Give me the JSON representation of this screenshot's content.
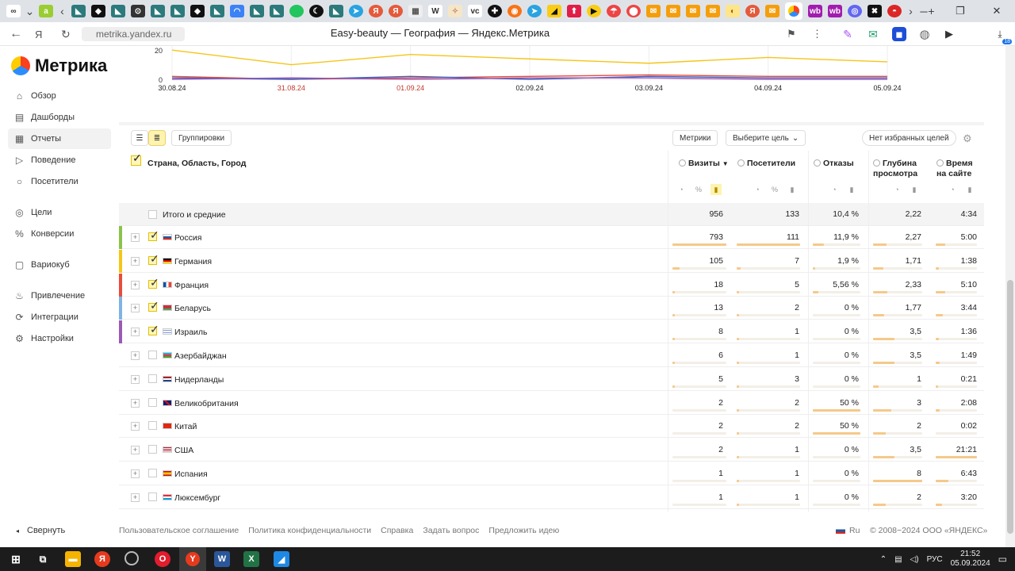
{
  "browser": {
    "url": "metrika.yandex.ru",
    "page_title": "Easy-beauty — География — Яндекс.Метрика",
    "tab_badge": "18"
  },
  "sidebar": {
    "logo": "Метрика",
    "items": [
      {
        "label": "Обзор",
        "icon": "home-icon"
      },
      {
        "label": "Дашборды",
        "icon": "dashboard-icon"
      },
      {
        "label": "Отчеты",
        "icon": "reports-icon",
        "active": true
      },
      {
        "label": "Поведение",
        "icon": "play-icon"
      },
      {
        "label": "Посетители",
        "icon": "user-icon"
      },
      {
        "label": "Цели",
        "icon": "target-icon"
      },
      {
        "label": "Конверсии",
        "icon": "percent-icon"
      },
      {
        "label": "Вариокуб",
        "icon": "cube-icon"
      },
      {
        "label": "Привлечение",
        "icon": "flame-icon"
      },
      {
        "label": "Интеграции",
        "icon": "plug-icon"
      },
      {
        "label": "Настройки",
        "icon": "gear-icon"
      }
    ],
    "collapse": "Свернуть"
  },
  "chart_data": {
    "type": "line",
    "x": [
      "30.08.24",
      "31.08.24",
      "01.09.24",
      "02.09.24",
      "03.09.24",
      "04.09.24",
      "05.09.24"
    ],
    "x_label_colors": [
      "#222",
      "#c0392b",
      "#c0392b",
      "#222",
      "#222",
      "#222",
      "#222"
    ],
    "y_ticks": [
      0,
      20
    ],
    "ylim": [
      0,
      25
    ],
    "series": [
      {
        "color": "#f5c518",
        "values": [
          20,
          10,
          17,
          14,
          11,
          15,
          12
        ]
      },
      {
        "color": "#e74c3c",
        "values": [
          2,
          0,
          1,
          2,
          3,
          2,
          2
        ]
      },
      {
        "color": "#3b5fc0",
        "values": [
          1,
          0,
          2,
          0,
          2,
          1,
          1
        ]
      },
      {
        "color": "#9b59b6",
        "values": [
          0,
          1,
          0,
          1,
          1,
          0,
          0
        ]
      }
    ]
  },
  "controls": {
    "groupings": "Группировки",
    "metrics": "Метрики",
    "choose_goal": "Выберите цель",
    "no_favorites": "Нет избранных целей"
  },
  "table": {
    "dimension_header": "Страна, Область, Город",
    "columns": [
      "Визиты",
      "Посетители",
      "Отказы",
      "Глубина просмотра",
      "Время на сайте"
    ],
    "col_visits": "Визиты",
    "col_visitors": "Посетители",
    "col_bounce": "Отказы",
    "col_depth_1": "Глубина",
    "col_depth_2": "просмотра",
    "col_time_1": "Время",
    "col_time_2": "на сайте",
    "sort_marker": "▼",
    "total": {
      "label": "Итого и средние",
      "visits": "956",
      "visitors": "133",
      "bounce": "10,4 %",
      "depth": "2,22",
      "time": "4:34"
    },
    "rows": [
      {
        "name": "Россия",
        "visits": "793",
        "visitors": "111",
        "bounce": "11,9 %",
        "depth": "2,27",
        "time": "5:00",
        "checked": true,
        "color": "#8bc34a",
        "vf": 1.0,
        "uf": 1.0,
        "bf": 0.24,
        "df": 0.28,
        "tf": 0.24
      },
      {
        "name": "Германия",
        "visits": "105",
        "visitors": "7",
        "bounce": "1,9 %",
        "depth": "1,71",
        "time": "1:38",
        "checked": true,
        "color": "#f5c518",
        "vf": 0.13,
        "uf": 0.06,
        "bf": 0.04,
        "df": 0.21,
        "tf": 0.08
      },
      {
        "name": "Франция",
        "visits": "18",
        "visitors": "5",
        "bounce": "5,56 %",
        "depth": "2,33",
        "time": "5:10",
        "checked": true,
        "color": "#e74c3c",
        "vf": 0.02,
        "uf": 0.04,
        "bf": 0.11,
        "df": 0.29,
        "tf": 0.24
      },
      {
        "name": "Беларусь",
        "visits": "13",
        "visitors": "2",
        "bounce": "0 %",
        "depth": "1,77",
        "time": "3:44",
        "checked": true,
        "color": "#7fb3e6",
        "vf": 0.02,
        "uf": 0.02,
        "bf": 0.0,
        "df": 0.22,
        "tf": 0.17
      },
      {
        "name": "Израиль",
        "visits": "8",
        "visitors": "1",
        "bounce": "0 %",
        "depth": "3,5",
        "time": "1:36",
        "checked": true,
        "color": "#9b59b6",
        "vf": 0.01,
        "uf": 0.01,
        "bf": 0.0,
        "df": 0.44,
        "tf": 0.07
      },
      {
        "name": "Азербайджан",
        "visits": "6",
        "visitors": "1",
        "bounce": "0 %",
        "depth": "3,5",
        "time": "1:49",
        "checked": false,
        "color": "",
        "vf": 0.01,
        "uf": 0.01,
        "bf": 0.0,
        "df": 0.44,
        "tf": 0.09
      },
      {
        "name": "Нидерланды",
        "visits": "5",
        "visitors": "3",
        "bounce": "0 %",
        "depth": "1",
        "time": "0:21",
        "checked": false,
        "color": "",
        "vf": 0.01,
        "uf": 0.03,
        "bf": 0.0,
        "df": 0.12,
        "tf": 0.02
      },
      {
        "name": "Великобритания",
        "visits": "2",
        "visitors": "2",
        "bounce": "50 %",
        "depth": "3",
        "time": "2:08",
        "checked": false,
        "color": "",
        "vf": 0.0,
        "uf": 0.02,
        "bf": 1.0,
        "df": 0.37,
        "tf": 0.1
      },
      {
        "name": "Китай",
        "visits": "2",
        "visitors": "2",
        "bounce": "50 %",
        "depth": "2",
        "time": "0:02",
        "checked": false,
        "color": "",
        "vf": 0.0,
        "uf": 0.02,
        "bf": 1.0,
        "df": 0.25,
        "tf": 0.0
      },
      {
        "name": "США",
        "visits": "2",
        "visitors": "1",
        "bounce": "0 %",
        "depth": "3,5",
        "time": "21:21",
        "checked": false,
        "color": "",
        "vf": 0.0,
        "uf": 0.01,
        "bf": 0.0,
        "df": 0.44,
        "tf": 1.0
      },
      {
        "name": "Испания",
        "visits": "1",
        "visitors": "1",
        "bounce": "0 %",
        "depth": "8",
        "time": "6:43",
        "checked": false,
        "color": "",
        "vf": 0.0,
        "uf": 0.01,
        "bf": 0.0,
        "df": 1.0,
        "tf": 0.31
      },
      {
        "name": "Люксембург",
        "visits": "1",
        "visitors": "1",
        "bounce": "0 %",
        "depth": "2",
        "time": "3:20",
        "checked": false,
        "color": "",
        "vf": 0.0,
        "uf": 0.01,
        "bf": 0.0,
        "df": 0.25,
        "tf": 0.16
      }
    ]
  },
  "footer": {
    "links": [
      "Пользовательское соглашение",
      "Политика конфиденциальности",
      "Справка",
      "Задать вопрос",
      "Предложить идею"
    ],
    "lang": "Ru",
    "copyright": "© 2008−2024 ООО «ЯНДЕКС»"
  },
  "taskbar": {
    "lang": "РУС",
    "time": "21:52",
    "date": "05.09.2024"
  }
}
